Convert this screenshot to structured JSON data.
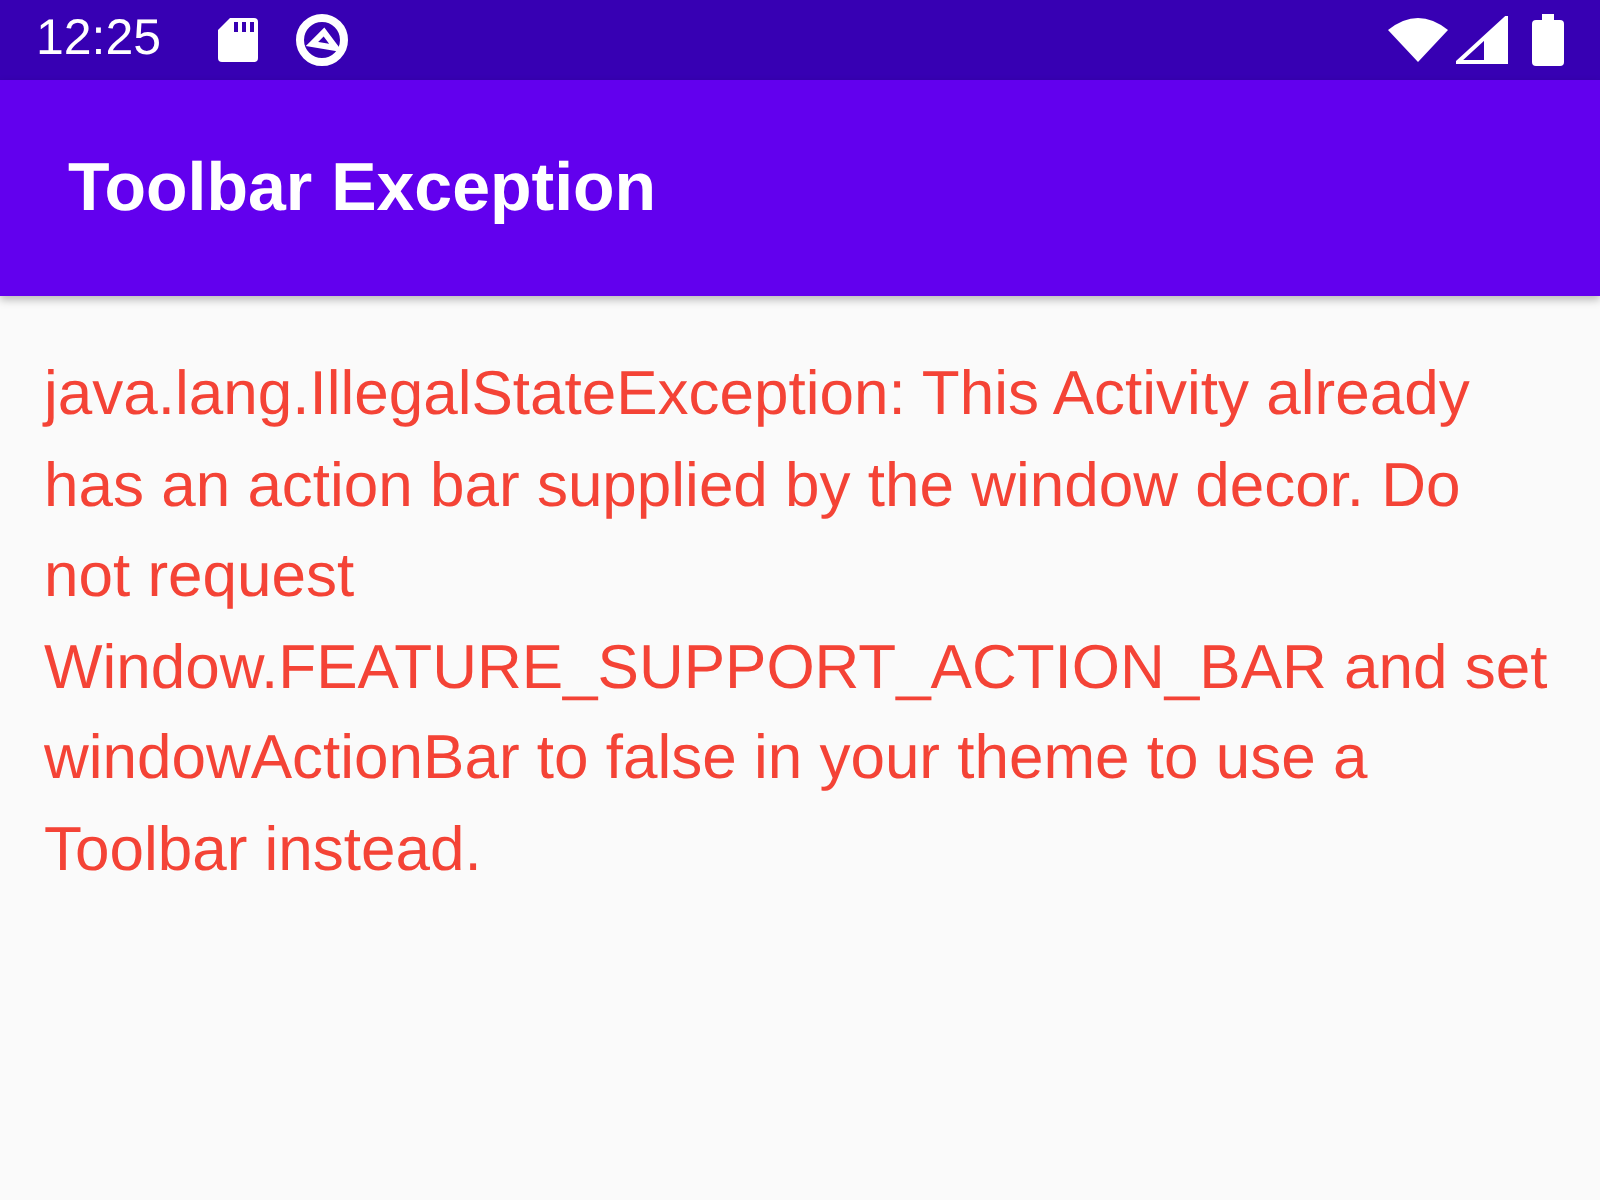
{
  "status_bar": {
    "time": "12:25"
  },
  "toolbar": {
    "title": "Toolbar Exception"
  },
  "message": "java.lang.IllegalStateException: This Activity already has an action bar supplied by the window decor. Do not request Window.FEATURE_SUPPORT_ACTION_BAR and set windowActionBar to false in your theme to use a Toolbar instead."
}
